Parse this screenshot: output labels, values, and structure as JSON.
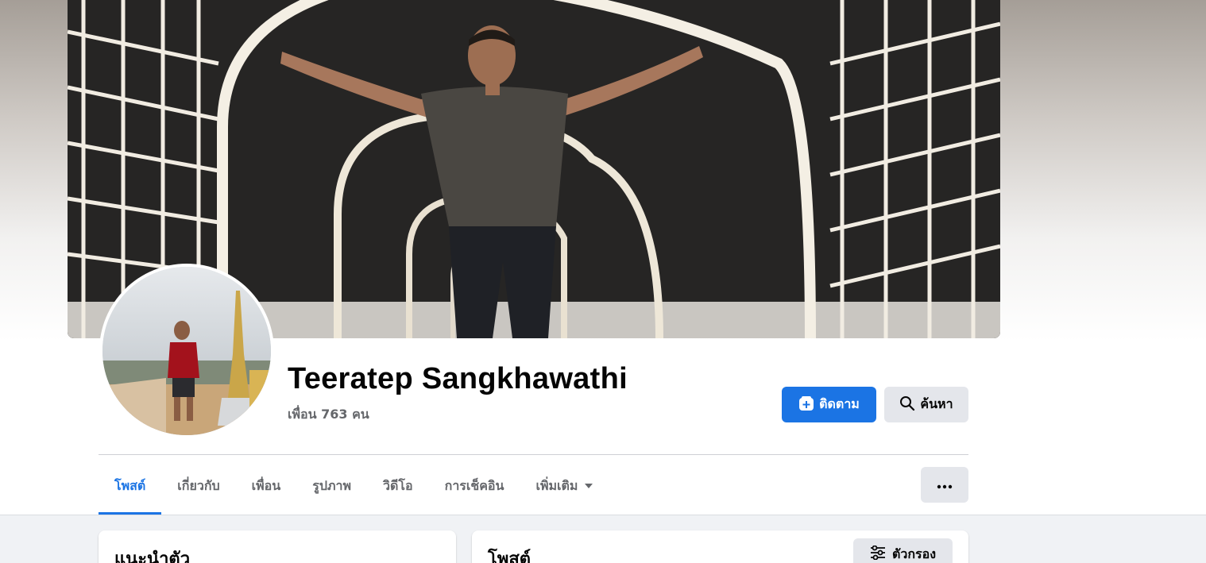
{
  "profile": {
    "name": "Teeratep Sangkhawathi",
    "friends_text": "เพื่อน 763 คน"
  },
  "actions": {
    "follow_label": "ติดตาม",
    "search_label": "ค้นหา"
  },
  "tabs": [
    {
      "label": "โพสต์",
      "active": true
    },
    {
      "label": "เกี่ยวกับ",
      "active": false
    },
    {
      "label": "เพื่อน",
      "active": false
    },
    {
      "label": "รูปภาพ",
      "active": false
    },
    {
      "label": "วิดีโอ",
      "active": false
    },
    {
      "label": "การเช็คอิน",
      "active": false
    },
    {
      "label": "เพิ่มเติม",
      "active": false
    }
  ],
  "sections": {
    "intro_title": "แนะนำตัว",
    "posts_title": "โพสต์",
    "filter_label": "ตัวกรอง"
  },
  "colors": {
    "primary": "#1b74e4",
    "secondary_button": "#e4e6eb",
    "muted_text": "#65676b",
    "feed_background": "#f0f2f5"
  },
  "icons": {
    "follow": "follow-plus-icon",
    "search": "search-icon",
    "dropdown": "caret-down-icon",
    "more": "more-dots-icon",
    "filter": "filter-sliders-icon"
  }
}
